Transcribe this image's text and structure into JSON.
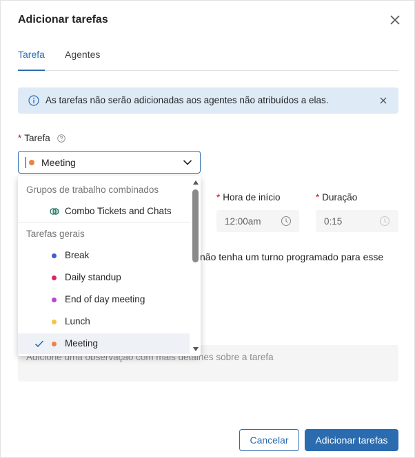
{
  "dialog": {
    "title": "Adicionar tarefas"
  },
  "tabs": [
    {
      "label": "Tarefa",
      "active": true
    },
    {
      "label": "Agentes",
      "active": false
    }
  ],
  "info_bar": {
    "text": "As tarefas não serão adicionadas aos agentes não atribuídos a elas."
  },
  "task_field": {
    "label": "Tarefa",
    "selected_value": "Meeting",
    "selected_color": "#e8834a"
  },
  "start_time": {
    "label": "Hora de início",
    "value": "12:00am"
  },
  "duration": {
    "label": "Duração",
    "value": "0:15"
  },
  "notice_text": "não tenha um turno programado para esse",
  "note": {
    "placeholder": "Adicione uma observação com mais detalhes sobre a tarefa"
  },
  "dropdown": {
    "groups": [
      {
        "header": "Grupos de trabalho combinados",
        "items": [
          {
            "label": "Combo Tickets and Chats",
            "color": "#2e7d6b"
          }
        ]
      },
      {
        "header": "Tarefas gerais",
        "items": [
          {
            "label": "Break",
            "color": "#3b5bdb"
          },
          {
            "label": "Daily standup",
            "color": "#e0245e"
          },
          {
            "label": "End of day meeting",
            "color": "#b844d8"
          },
          {
            "label": "Lunch",
            "color": "#f5c542"
          },
          {
            "label": "Meeting",
            "color": "#e8834a",
            "selected": true
          }
        ]
      }
    ]
  },
  "buttons": {
    "cancel": "Cancelar",
    "submit": "Adicionar tarefas"
  },
  "colors": {
    "accent": "#2b6cb0",
    "info_bg": "#deeaf6",
    "required": "#c50f1f"
  }
}
